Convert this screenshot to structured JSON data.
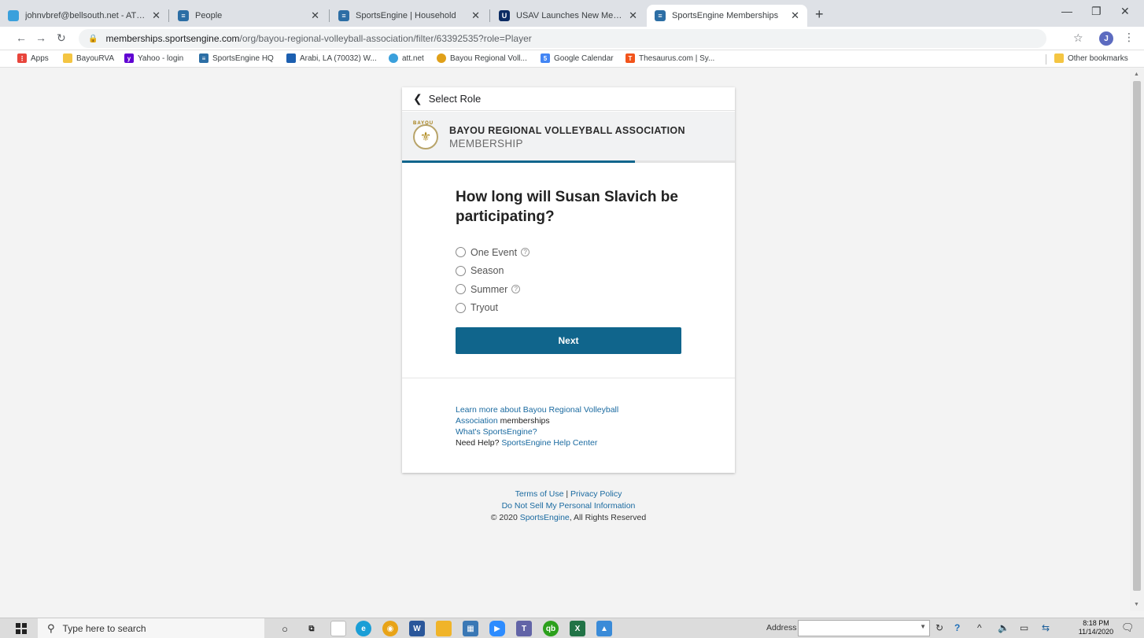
{
  "browser": {
    "tabs": [
      {
        "title": "johnvbref@bellsouth.net - AT&T",
        "active": false
      },
      {
        "title": "People",
        "active": false
      },
      {
        "title": "SportsEngine | Household",
        "active": false
      },
      {
        "title": "USAV Launches New Membership",
        "active": false
      },
      {
        "title": "SportsEngine Memberships",
        "active": true
      }
    ],
    "url_domain": "memberships.sportsengine.com",
    "url_path": "/org/bayou-regional-volleyball-association/filter/63392535?role=Player",
    "profile_initial": "J",
    "bookmarks": [
      {
        "label": "Apps",
        "color": "#e8453c"
      },
      {
        "label": "BayouRVA",
        "color": "#f4c542"
      },
      {
        "label": "Yahoo - login",
        "color": "#6001d2"
      },
      {
        "label": "SportsEngine HQ",
        "color": "#2c6ea5"
      },
      {
        "label": "Arabi, LA (70032) W...",
        "color": "#1c5fb0"
      },
      {
        "label": "att.net",
        "color": "#3aa0dc"
      },
      {
        "label": "Bayou Regional Voll...",
        "color": "#e0a019"
      },
      {
        "label": "Google Calendar",
        "color": "#4285f4"
      },
      {
        "label": "Thesaurus.com | Sy...",
        "color": "#f2541b"
      }
    ],
    "other_bookmarks": "Other bookmarks"
  },
  "page": {
    "back_label": "Select Role",
    "org_name": "BAYOU REGIONAL VOLLEYBALL ASSOCIATION",
    "org_sub": "MEMBERSHIP",
    "logo_text": "BAYOU",
    "progress": 0.7,
    "question": "How long will Susan Slavich be participating?",
    "options": [
      {
        "label": "One Event",
        "help": true
      },
      {
        "label": "Season",
        "help": false
      },
      {
        "label": "Summer",
        "help": true
      },
      {
        "label": "Tryout",
        "help": false
      }
    ],
    "next_label": "Next",
    "learn_more_link": "Learn more about Bayou Regional Volleyball Association",
    "learn_more_suffix": " memberships",
    "whats_se_link": "What's SportsEngine?",
    "need_help_prefix": "Need Help? ",
    "help_center_link": "SportsEngine Help Center",
    "terms": "Terms of Use",
    "footer_sep": " | ",
    "privacy": "Privacy Policy",
    "do_not_sell": "Do Not Sell My Personal Information",
    "copyright_prefix": "© 2020 ",
    "copyright_link": "SportsEngine",
    "copyright_suffix": ", All Rights Reserved"
  },
  "taskbar": {
    "search_placeholder": "Type here to search",
    "address_label": "Address",
    "time": "8:18 PM",
    "date": "11/14/2020"
  }
}
